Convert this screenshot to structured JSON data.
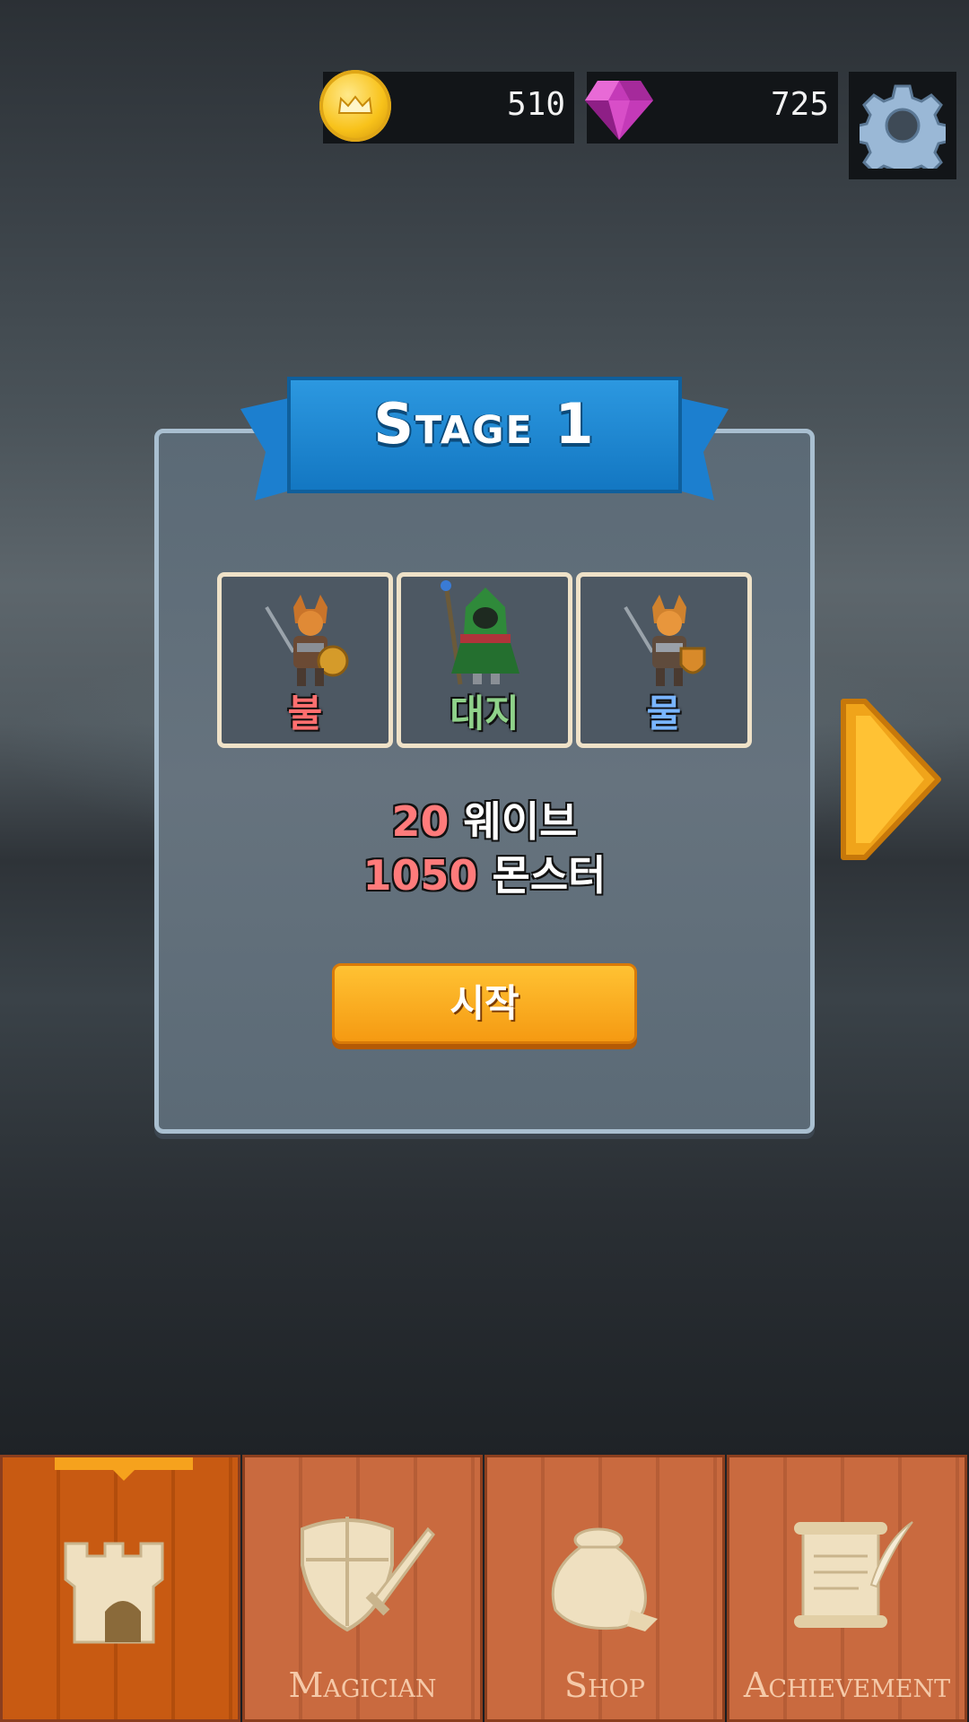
{
  "currency": {
    "gold": "510",
    "gems": "725"
  },
  "stage": {
    "title": "Stage 1",
    "elements": [
      {
        "label": "불",
        "color": "#ff6f6f",
        "icon": "fox-warrior-icon"
      },
      {
        "label": "대지",
        "color": "#8fd28a",
        "icon": "green-mage-icon"
      },
      {
        "label": "물",
        "color": "#79b5ff",
        "icon": "fox-warrior-icon"
      }
    ],
    "waves_num": "20",
    "waves_label": "웨이브",
    "monsters_num": "1050",
    "monsters_label": "몬스터",
    "start_label": "시작"
  },
  "nav": {
    "tabs": [
      {
        "label": "",
        "icon": "castle-icon",
        "active": true
      },
      {
        "label": "Magician",
        "icon": "shield-sword-icon",
        "active": false
      },
      {
        "label": "Shop",
        "icon": "money-bag-icon",
        "active": false
      },
      {
        "label": "Achievement",
        "icon": "scroll-quill-icon",
        "active": false
      }
    ]
  },
  "colors": {
    "accent_orange": "#f59a12",
    "banner_blue": "#1c7fcf",
    "fire": "#ff6f6f",
    "earth": "#8fd28a",
    "water": "#79b5ff"
  }
}
